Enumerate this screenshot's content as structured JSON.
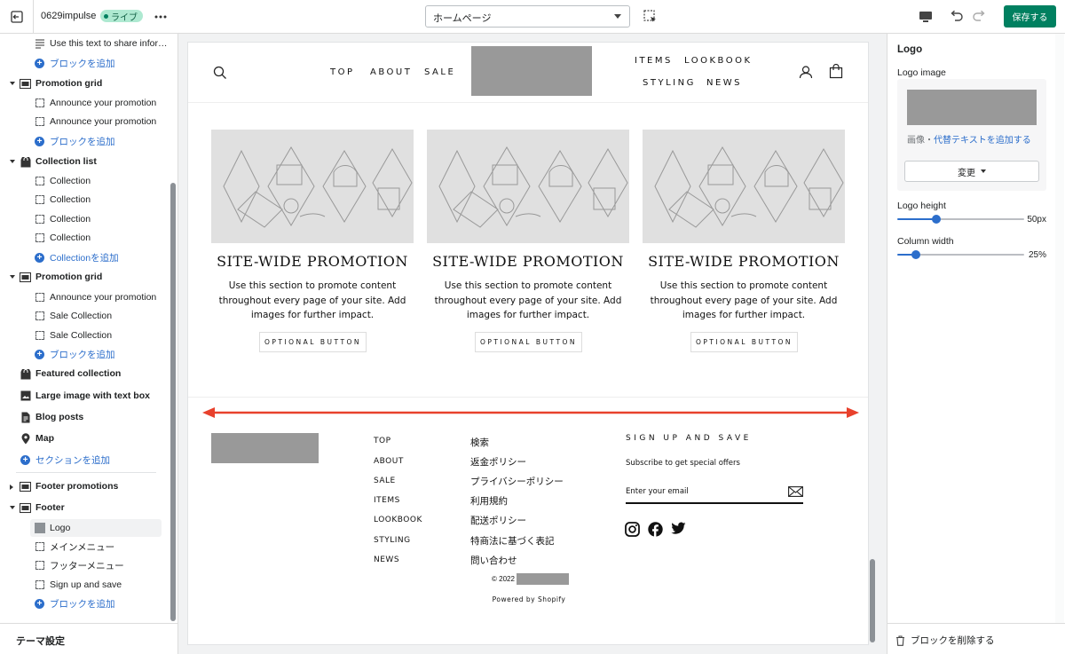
{
  "topbar": {
    "theme_name": "0629impulse",
    "live_badge": "ライブ",
    "page_select": "ホームページ",
    "save_label": "保存する"
  },
  "sidebar": {
    "rows": [
      {
        "label": "Use this text to share infor…",
        "kind": "block",
        "icon": "text-lines-icon"
      },
      {
        "label": "ブロックを追加",
        "kind": "add"
      },
      {
        "label": "Promotion grid",
        "kind": "section",
        "expanded": true
      },
      {
        "label": "Announce your promotion",
        "kind": "block"
      },
      {
        "label": "Announce your promotion",
        "kind": "block"
      },
      {
        "label": "ブロックを追加",
        "kind": "add"
      },
      {
        "label": "Collection list",
        "kind": "section",
        "expanded": true
      },
      {
        "label": "Collection",
        "kind": "block"
      },
      {
        "label": "Collection",
        "kind": "block"
      },
      {
        "label": "Collection",
        "kind": "block"
      },
      {
        "label": "Collection",
        "kind": "block"
      },
      {
        "label": "Collectionを追加",
        "kind": "add"
      },
      {
        "label": "Promotion grid",
        "kind": "section",
        "expanded": true
      },
      {
        "label": "Announce your promotion",
        "kind": "block"
      },
      {
        "label": "Sale Collection",
        "kind": "block"
      },
      {
        "label": "Sale Collection",
        "kind": "block"
      },
      {
        "label": "ブロックを追加",
        "kind": "add"
      },
      {
        "label": "Featured collection",
        "kind": "section"
      },
      {
        "label": "Large image with text box",
        "kind": "section"
      },
      {
        "label": "Blog posts",
        "kind": "section"
      },
      {
        "label": "Map",
        "kind": "section"
      },
      {
        "label": "セクションを追加",
        "kind": "add"
      },
      {
        "label": "Footer promotions",
        "kind": "section",
        "expanded": false
      },
      {
        "label": "Footer",
        "kind": "section",
        "expanded": true
      },
      {
        "label": "Logo",
        "kind": "block",
        "selected": true
      },
      {
        "label": "メインメニュー",
        "kind": "block"
      },
      {
        "label": "フッターメニュー",
        "kind": "block"
      },
      {
        "label": "Sign up and save",
        "kind": "block"
      },
      {
        "label": "ブロックを追加",
        "kind": "add"
      }
    ],
    "theme_settings": "テーマ設定"
  },
  "preview": {
    "nav_left": [
      "TOP",
      "ABOUT",
      "SALE"
    ],
    "nav_right_top": [
      "ITEMS",
      "LOOKBOOK"
    ],
    "nav_right_bottom": [
      "STYLING",
      "NEWS"
    ],
    "promos": [
      {
        "title": "SITE-WIDE PROMOTION",
        "text": "Use this section to promote content throughout every page of your site. Add images for further impact.",
        "button": "OPTIONAL BUTTON"
      },
      {
        "title": "SITE-WIDE PROMOTION",
        "text": "Use this section to promote content throughout every page of your site. Add images for further impact.",
        "button": "OPTIONAL BUTTON"
      },
      {
        "title": "SITE-WIDE PROMOTION",
        "text": "Use this section to promote content throughout every page of your site. Add images for further impact.",
        "button": "OPTIONAL BUTTON"
      }
    ],
    "footer_main_menu": [
      "TOP",
      "ABOUT",
      "SALE",
      "ITEMS",
      "LOOKBOOK",
      "STYLING",
      "NEWS"
    ],
    "footer_menu": [
      "検索",
      "返金ポリシー",
      "プライバシーポリシー",
      "利用規約",
      "配送ポリシー",
      "特商法に基づく表記",
      "問い合わせ"
    ],
    "signup_title": "SIGN UP AND SAVE",
    "signup_sub": "Subscribe to get special offers",
    "email_placeholder": "Enter your email",
    "copyright": "© 2022",
    "powered": "Powered by Shopify",
    "arrow_color": "#e8412c"
  },
  "right_panel": {
    "title": "Logo",
    "logo_image_label": "Logo image",
    "image_text": "画像・",
    "alt_link": "代替テキストを追加する",
    "change_label": "変更",
    "logo_height_label": "Logo height",
    "logo_height_value": "50px",
    "logo_height_fraction": 0.31,
    "column_width_label": "Column width",
    "column_width_value": "25%",
    "column_width_fraction": 0.15,
    "remove_label": "ブロックを削除する"
  },
  "colors": {
    "accent": "#2c6ecb",
    "save": "#008060",
    "live_badge_bg": "#aee9d1"
  }
}
